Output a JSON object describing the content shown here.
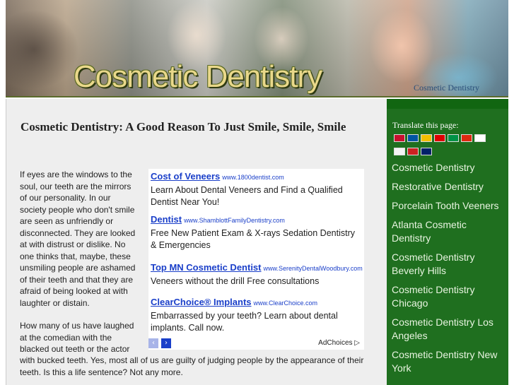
{
  "header": {
    "title": "Cosmetic Dentistry",
    "subtitle": "Cosmetic Dentistry"
  },
  "article": {
    "title": "Cosmetic Dentistry: A Good Reason To Just Smile, Smile, Smile",
    "para1": "If eyes are the windows to the soul, our teeth are the mirrors of our personality. In our society people who don't smile are seen as unfriendly or disconnected. They are looked at with distrust or dislike. No one thinks that, maybe, these unsmiling people are ashamed of their teeth and that they are afraid of being looked at with laughter or distain.",
    "para2_start": "How many of us have laughed at the comedian with the blacked out teeth or the actor",
    "para2_end": "with bucked teeth. Yes, most all of us are guilty of judging people by the appearance of their teeth. Is this a life sentence? Not any more."
  },
  "ads": {
    "items": [
      {
        "title": "Cost of Veneers",
        "url": "www.1800dentist.com",
        "desc": "Learn About Dental Veneers and Find a Qualified Dentist Near You!"
      },
      {
        "title": "Dentist",
        "url": "www.ShamblottFamilyDentistry.com",
        "desc": "Free New Patient Exam & X-rays Sedation Dentistry & Emergencies"
      },
      {
        "title": "Top MN Cosmetic Dentist",
        "url": "www.SerenityDentalWoodbury.com",
        "desc": "Veneers without the drill Free consultations"
      },
      {
        "title": "ClearChoice® Implants",
        "url": "www.ClearChoice.com",
        "desc": "Embarrassed by your teeth? Learn about dental implants. Call now."
      }
    ],
    "adchoices": "AdChoices ▷",
    "prev_icon": "‹",
    "next_icon": "›"
  },
  "sidebar": {
    "translate_label": "Translate this page:",
    "flags": [
      {
        "name": "arabic-flag",
        "color": "#c8102e"
      },
      {
        "name": "french-flag",
        "color": "#0055a4"
      },
      {
        "name": "spanish-flag",
        "color": "#f1bf00"
      },
      {
        "name": "german-flag",
        "color": "#dd0000"
      },
      {
        "name": "italian-flag",
        "color": "#009246"
      },
      {
        "name": "chinese-flag",
        "color": "#de2910"
      },
      {
        "name": "japanese-flag",
        "color": "#ffffff"
      },
      {
        "name": "korean-flag",
        "color": "#f4f4f4"
      },
      {
        "name": "portuguese-flag",
        "color": "#cc2222"
      },
      {
        "name": "english-flag",
        "color": "#012169"
      }
    ],
    "items": [
      "Cosmetic Dentistry",
      "Restorative Dentistry",
      "Porcelain Tooth Veeners",
      "Atlanta Cosmetic Dentistry",
      "Cosmetic Dentistry Beverly Hills",
      "Cosmetic Dentistry Chicago",
      "Cosmetic Dentistry Los Angeles",
      "Cosmetic Dentistry New York"
    ]
  }
}
